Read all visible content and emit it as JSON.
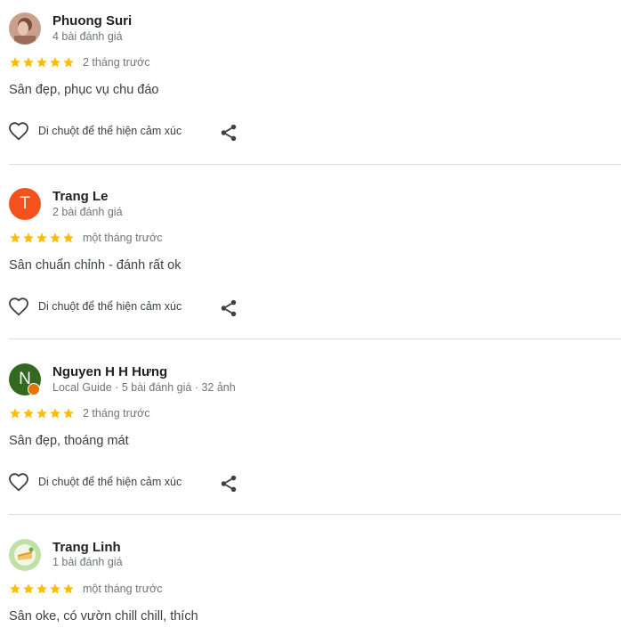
{
  "colors": {
    "star": "#fbbc04",
    "divider": "#dadce0",
    "avatar_t": "#f4511e",
    "avatar_n": "#33691e",
    "badge": "#e37400"
  },
  "reviews": [
    {
      "name": "Phuong Suri",
      "meta": "4 bài đánh giá",
      "rating": 5,
      "date": "2 tháng trước",
      "text": "Sân đẹp, phục vụ chu đáo",
      "react_label": "Di chuột để thể hiện cảm xúc",
      "avatar_type": "photo"
    },
    {
      "name": "Trang Le",
      "meta": "2 bài đánh giá",
      "rating": 5,
      "date": "một tháng trước",
      "text": "Sân chuẩn chỉnh - đánh rất ok",
      "react_label": "Di chuột để thể hiện cảm xúc",
      "avatar_letter": "T"
    },
    {
      "name": "Nguyen H H Hưng",
      "meta": "Local Guide · 5 bài đánh giá · 32 ảnh",
      "rating": 5,
      "date": "2 tháng trước",
      "text": "Sân đẹp, thoáng mát",
      "react_label": "Di chuột để thể hiện cảm xúc",
      "avatar_letter": "N"
    },
    {
      "name": "Trang Linh",
      "meta": "1 bài đánh giá",
      "rating": 5,
      "date": "một tháng trước",
      "text": "Sân oke, có vườn chill chill, thích",
      "avatar_type": "photo"
    }
  ]
}
